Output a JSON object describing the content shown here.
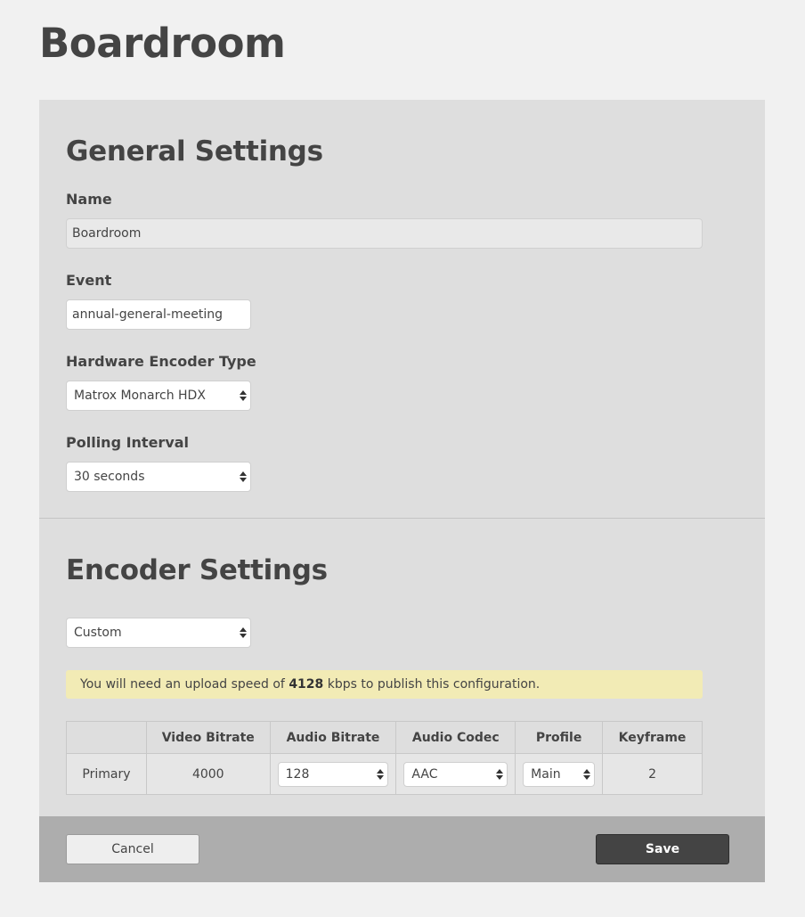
{
  "page": {
    "title": "Boardroom"
  },
  "general": {
    "title": "General Settings",
    "name_label": "Name",
    "name_value": "Boardroom",
    "event_label": "Event",
    "event_value": "annual-general-meeting",
    "encoder_type_label": "Hardware Encoder Type",
    "encoder_type_value": "Matrox Monarch HDX",
    "polling_label": "Polling Interval",
    "polling_value": "30 seconds"
  },
  "encoder": {
    "title": "Encoder Settings",
    "preset_value": "Custom",
    "notice": {
      "before": "You will need an upload speed of",
      "speed": "4128",
      "after": "kbps to publish this configuration."
    },
    "table": {
      "headers": [
        "",
        "Video Bitrate",
        "Audio Bitrate",
        "Audio Codec",
        "Profile",
        "Keyframe"
      ],
      "rows": [
        {
          "name": "Primary",
          "video_bitrate": "4000",
          "audio_bitrate": "128",
          "audio_codec": "AAC",
          "profile": "Main",
          "keyframe": "2"
        }
      ]
    }
  },
  "footer": {
    "cancel_label": "Cancel",
    "save_label": "Save"
  },
  "colors": {
    "accent_dark": "#444444",
    "notice_bg": "#f2ebb5",
    "panel_bg": "#dedede",
    "footer_bg": "#adadad"
  }
}
